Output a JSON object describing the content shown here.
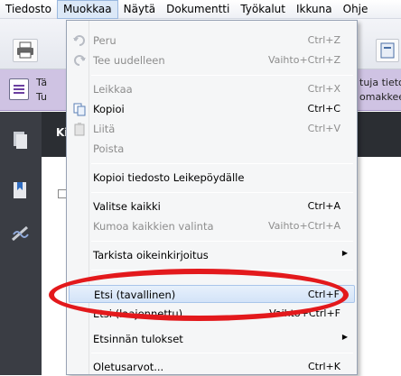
{
  "menubar": {
    "items": [
      "Tiedosto",
      "Muokkaa",
      "Näytä",
      "Dokumentti",
      "Työkalut",
      "Ikkuna",
      "Ohje"
    ]
  },
  "infobar": {
    "left_line1": "Tä",
    "left_line2": "Tu",
    "right_line1": "tuja tieto",
    "right_line2": "omakkee"
  },
  "darkstrip": {
    "text": "Ki"
  },
  "menu": {
    "peru": {
      "label": "Peru",
      "shortcut": "Ctrl+Z"
    },
    "tee_uudelleen": {
      "label": "Tee uudelleen",
      "shortcut": "Vaihto+Ctrl+Z"
    },
    "leikkaa": {
      "label": "Leikkaa",
      "shortcut": "Ctrl+X"
    },
    "kopioi": {
      "label": "Kopioi",
      "shortcut": "Ctrl+C"
    },
    "liita": {
      "label": "Liitä",
      "shortcut": "Ctrl+V"
    },
    "poista": {
      "label": "Poista"
    },
    "kopioi_tiedosto": {
      "label": "Kopioi tiedosto Leikepöydälle"
    },
    "valitse_kaikki": {
      "label": "Valitse kaikki",
      "shortcut": "Ctrl+A"
    },
    "kumoa_kaikkien": {
      "label": "Kumoa kaikkien valinta",
      "shortcut": "Vaihto+Ctrl+A"
    },
    "tarkista": {
      "label": "Tarkista oikeinkirjoitus"
    },
    "etsi": {
      "label": "Etsi (tavallinen)",
      "shortcut": "Ctrl+F"
    },
    "etsi_laajennettu": {
      "label": "Etsi (laajennettu)",
      "shortcut": "Vaihto+Ctrl+F"
    },
    "etsinnan_tulokset": {
      "label": "Etsinnän tulokset"
    },
    "oletusarvot": {
      "label": "Oletusarvot...",
      "shortcut": "Ctrl+K"
    }
  },
  "colors": {
    "annotation": "#e3191c",
    "infobar": "#cfc3e3",
    "highlight": "#d3e3f8"
  }
}
